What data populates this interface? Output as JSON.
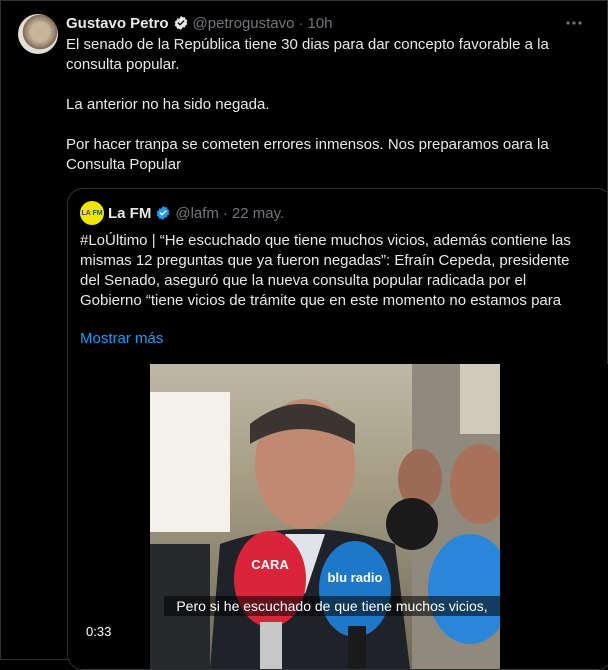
{
  "tweet": {
    "author_name": "Gustavo Petro",
    "handle": "@petrogustavo",
    "separator": "·",
    "time": "10h",
    "paragraphs": [
      "El senado de la República tiene 30 dias para dar concepto favorable a la consulta popular.",
      "La anterior no ha sido negada.",
      "Por hacer tranpa se cometen errores inmensos. Nos preparamos oara la Consulta Popular"
    ]
  },
  "quoted": {
    "author_name": "La FM",
    "avatar_text": "LA FM",
    "handle": "@lafm",
    "separator": "·",
    "date": "22 may.",
    "text": "#LoÚltimo | “He escuchado que tiene muchos vicios, además contiene las mismas 12 preguntas que ya fueron negadas”: Efraín Cepeda, presidente del Senado, aseguró que la nueva consulta popular radicada por el Gobierno “tiene vicios de trámite que en este momento no estamos para",
    "show_more": "Mostrar más",
    "video": {
      "caption": "Pero si he escuchado de que tiene muchos vicios,",
      "duration": "0:33",
      "mic_labels": [
        "CARA",
        "blu radio"
      ]
    }
  },
  "colors": {
    "accent": "#1d9bf0",
    "background": "#000000",
    "muted": "#71767b",
    "lafm_yellow": "#f2e600"
  }
}
